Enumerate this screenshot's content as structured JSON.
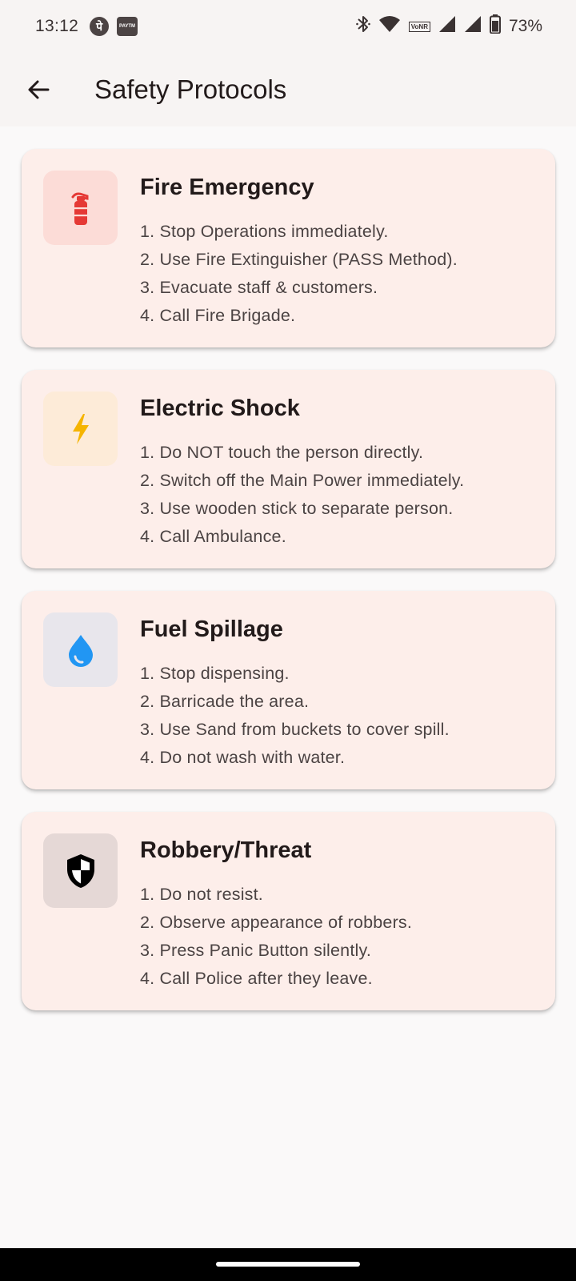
{
  "status_bar": {
    "time": "13:12",
    "phonepe_glyph": "पे",
    "paytm_label": "PAYTM",
    "volte_label": "VoNR",
    "battery_percent": "73%",
    "icons": [
      "phonepe-icon",
      "paytm-icon",
      "bluetooth-icon",
      "wifi-icon",
      "volte-icon",
      "signal-icon",
      "signal-icon",
      "battery-icon"
    ]
  },
  "app_bar": {
    "title": "Safety Protocols",
    "back_icon": "arrow-back-icon"
  },
  "cards": [
    {
      "title": "Fire Emergency",
      "icon": "fire-extinguisher-icon",
      "icon_color": "#e53935",
      "icon_bg": "#fcdcd7",
      "steps": [
        "1. Stop Operations immediately.",
        "2. Use Fire Extinguisher (PASS Method).",
        "3. Evacuate staff & customers.",
        "4. Call Fire Brigade."
      ]
    },
    {
      "title": "Electric Shock",
      "icon": "lightning-bolt-icon",
      "icon_color": "#f5b400",
      "icon_bg": "#fdebd8",
      "steps": [
        "1. Do NOT touch the person directly.",
        "2. Switch off the Main Power immediately.",
        "3. Use wooden stick to separate person.",
        "4. Call Ambulance."
      ]
    },
    {
      "title": "Fuel Spillage",
      "icon": "water-drop-icon",
      "icon_color": "#2196f3",
      "icon_bg": "#e8e6ec",
      "steps": [
        "1. Stop dispensing.",
        "2. Barricade the area.",
        "3. Use Sand from buckets to cover spill.",
        "4. Do not wash with water."
      ]
    },
    {
      "title": "Robbery/Threat",
      "icon": "shield-icon",
      "icon_color": "#000000",
      "icon_bg": "#e5d8d6",
      "steps": [
        "1. Do not resist.",
        "2. Observe appearance of robbers.",
        "3. Press Panic Button silently.",
        "4. Call Police after they leave."
      ]
    }
  ]
}
